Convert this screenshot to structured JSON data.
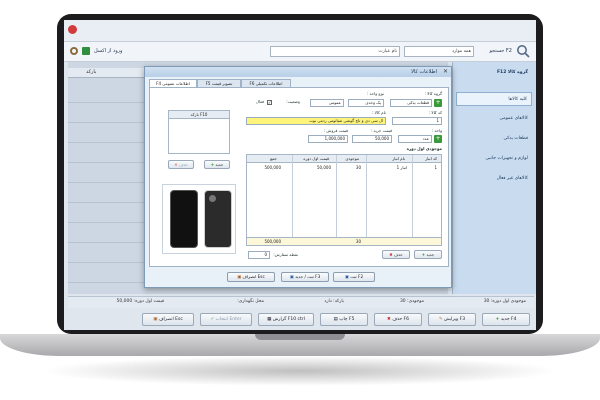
{
  "app": {
    "title": "جستجو F2",
    "search_placeholder": "همه موارد",
    "search_field2": "نام عبارت",
    "toolbar_right_label": "ورود از اکسل",
    "search_icon": "search-icon"
  },
  "sidebar": {
    "header": "گروه کالا F12",
    "items": [
      {
        "label": "کلیه کالاها"
      },
      {
        "label": "کالاهای عمومی"
      },
      {
        "label": "قطعات یدکی"
      },
      {
        "label": "لوازم و تجهیزات جانبی"
      },
      {
        "label": "کالاهای غیر فعال"
      }
    ]
  },
  "grid": {
    "columns": [
      "بارکد"
    ]
  },
  "status": {
    "item1": "موجودی اول دوره: 30",
    "item2": "موجودی: 30",
    "item3": "بارکد: دارد",
    "item4": "محل نگهداری:",
    "item5": "قیمت اول دوره: 50,000"
  },
  "buttons": {
    "new": "جدید F4",
    "edit": "ویرایش F3",
    "delete": "حذف F6",
    "print": "چاپ F5",
    "report": "گزارش F10 ctrl",
    "select": "انتخاب Enter",
    "exit": "انصراف Esc"
  },
  "dialog": {
    "title": "اطلاعات کالا",
    "tabs": [
      "اطلاعات عمومی F4",
      "تصویر قیمت F5",
      "اطلاعات تکمیلی F6"
    ],
    "group_label": "گروه کالا :",
    "group_value": "قطعات یدکی",
    "type_label": "نوع واحد :",
    "type_value": "یک وحدی",
    "kind_value": "عمومی",
    "status_label": "وضعیت:",
    "active_label": "فعال",
    "code_label": "کد کالا :",
    "code_value": "1",
    "name_label": "نام کالا :",
    "name_value": "ال سی دی و تاچ گوشی شیائومی ردمی نوت",
    "unit_label": "واحد :",
    "unit_value": "عدد",
    "buy_label": "قیمت خرید :",
    "buy_value": "50,000",
    "sell_label": "قیمت فروش :",
    "sell_value": "1,000,000",
    "opening_title": "موجودی اول دوره",
    "opening_cols": [
      "کد انبار",
      "نام انبار",
      "موجودی",
      "قیمت اول دوره",
      "جمع"
    ],
    "opening_row": [
      "1",
      "انبار 1",
      "30",
      "50,000",
      "500,000"
    ],
    "opening_total_qty": "30",
    "opening_total_sum": "500,000",
    "order_point_label": "نقطه سفارش:",
    "order_point_value": "0",
    "barcode_header": "بارکد F10",
    "add_btn": "جدید",
    "delete_btn": "حذف",
    "save_btn": "ثبت F2",
    "save_new_btn": "ثبت / جدید F3",
    "cancel_btn": "انصراف Esc"
  }
}
